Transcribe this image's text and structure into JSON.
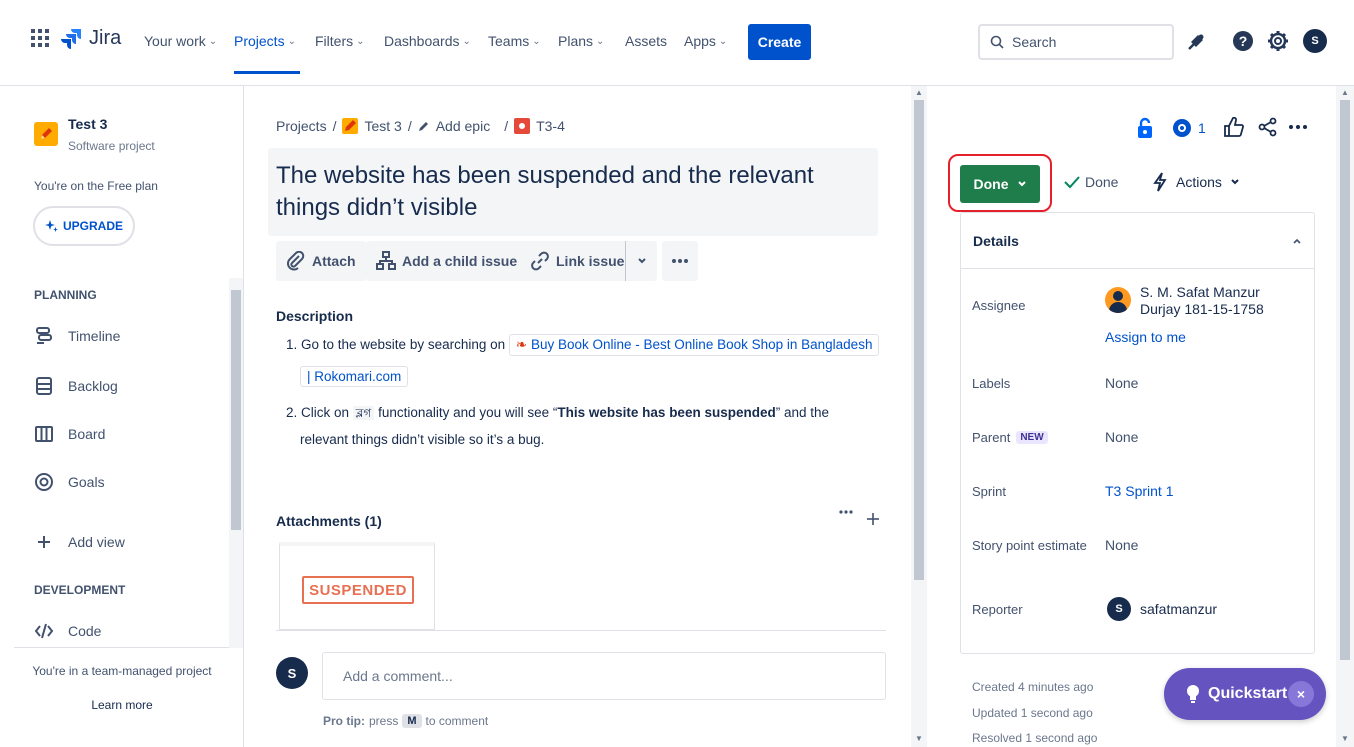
{
  "nav": {
    "logo": "Jira",
    "items": [
      {
        "label": "Your work",
        "chev": "⌄"
      },
      {
        "label": "Projects",
        "chev": "⌄"
      },
      {
        "label": "Filters",
        "chev": "⌄"
      },
      {
        "label": "Dashboards",
        "chev": "⌄"
      },
      {
        "label": "Teams",
        "chev": "⌄"
      },
      {
        "label": "Plans",
        "chev": "⌄"
      },
      {
        "label": "Assets",
        "chev": ""
      },
      {
        "label": "Apps",
        "chev": "⌄"
      }
    ],
    "create_label": "Create",
    "search_placeholder": "Search",
    "avatar_initial": "S"
  },
  "sidebar": {
    "project_name": "Test 3",
    "project_type": "Software project",
    "plan_text": "You're on the Free plan",
    "upgrade_label": "UPGRADE",
    "planning_heading": "PLANNING",
    "planning_items": [
      "Timeline",
      "Backlog",
      "Board",
      "Goals"
    ],
    "add_view_label": "Add view",
    "development_heading": "DEVELOPMENT",
    "code_label": "Code",
    "team_managed_text": "You're in a team-managed project",
    "learn_more": "Learn more"
  },
  "issue": {
    "breadcrumb": {
      "projects": "Projects",
      "project": "Test 3",
      "epic": "Add epic",
      "key": "T3-4",
      "sep": "/"
    },
    "title": "The website has been suspended and the relevant things didn’t visible",
    "toolbar": {
      "attach": "Attach",
      "child": "Add a child issue",
      "link": "Link issue"
    },
    "description_heading": "Description",
    "desc1_prefix": "1. Go to the website by searching on",
    "desc1_link_a": "Buy Book Online - Best Online Book Shop in Bangladesh",
    "desc1_link_b": "| Rokomari.com",
    "desc2_prefix": "2.  Click on",
    "desc2_code": "ব্লগ",
    "desc2_mid": "functionality and you will see “",
    "desc2_bold": "This website has been suspended",
    "desc2_suffix": "” and the",
    "desc2_line2": "relevant things didn’t visible so it’s a bug.",
    "attachments_heading": "Attachments (1)",
    "attachment_thumb_text": "SUSPENDED",
    "comment_placeholder": "Add a comment...",
    "protip_label": "Pro tip:",
    "protip_press": "press",
    "protip_key": "M",
    "protip_suffix": "to comment"
  },
  "right": {
    "watch_count": "1",
    "status_label": "Done",
    "resolution_label": "Done",
    "actions_label": "Actions",
    "details_heading": "Details",
    "fields": {
      "assignee_label": "Assignee",
      "assignee_name_1": "S. M. Safat Manzur",
      "assignee_name_2": "Durjay 181-15-1758",
      "assign_to_me": "Assign to me",
      "labels_label": "Labels",
      "labels_value": "None",
      "parent_label": "Parent",
      "parent_badge": "NEW",
      "parent_value": "None",
      "sprint_label": "Sprint",
      "sprint_value": "T3 Sprint 1",
      "story_label": "Story point estimate",
      "story_value": "None",
      "reporter_label": "Reporter",
      "reporter_initial": "S",
      "reporter_value": "safatmanzur"
    },
    "created": "Created 4 minutes ago",
    "updated": "Updated 1 second ago",
    "resolved": "Resolved 1 second ago",
    "quickstart_label": "Quickstart",
    "quickstart_close": "×"
  },
  "colors": {
    "brand": "#0052cc",
    "done_green": "#1e7d4a",
    "quickstart": "#6554c0",
    "annotation_red": "#e5202b"
  }
}
